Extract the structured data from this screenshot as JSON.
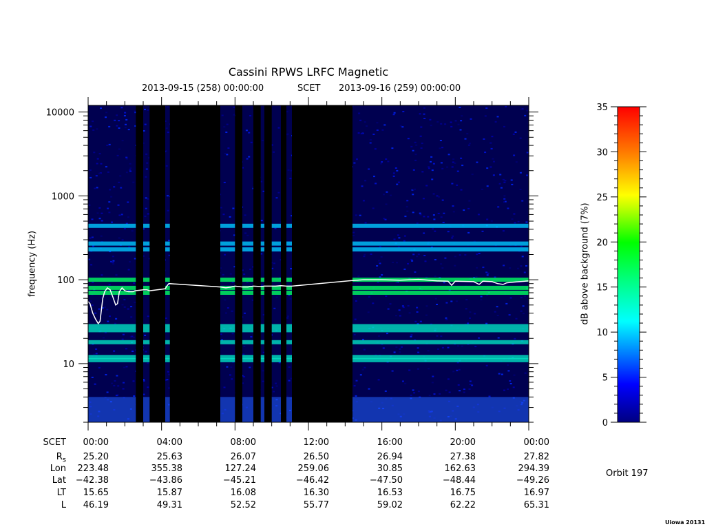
{
  "header": {
    "title": "Cassini RPWS LRFC Magnetic",
    "start_time": "2013-09-15 (258) 00:00:00",
    "scet_label": "SCET",
    "end_time": "2013-09-16 (259) 00:00:00"
  },
  "orbit_label": "Orbit 197",
  "credit": "Uiowa 20131008",
  "ephemeris": {
    "labels": [
      "SCET",
      "R",
      "Lon",
      "Lat",
      "LT",
      "L"
    ],
    "r_subscript": "s",
    "scet": [
      "00:00",
      "04:00",
      "08:00",
      "12:00",
      "16:00",
      "20:00",
      "00:00"
    ],
    "rs": [
      "25.20",
      "25.63",
      "26.07",
      "26.50",
      "26.94",
      "27.38",
      "27.82"
    ],
    "lon": [
      "223.48",
      "355.38",
      "127.24",
      "259.06",
      "30.85",
      "162.63",
      "294.39"
    ],
    "lat": [
      "−42.38",
      "−43.86",
      "−45.21",
      "−46.42",
      "−47.50",
      "−48.44",
      "−49.26"
    ],
    "lt": [
      "15.65",
      "15.87",
      "16.08",
      "16.30",
      "16.53",
      "16.75",
      "16.97"
    ],
    "l": [
      "46.19",
      "49.31",
      "52.52",
      "55.77",
      "59.02",
      "62.22",
      "65.31"
    ]
  },
  "chart_data": [
    {
      "type": "heatmap",
      "title": "Cassini RPWS LRFC Magnetic",
      "xlabel": "SCET",
      "ylabel": "frequency (Hz)",
      "y_scale": "log",
      "ylim": [
        2,
        12000
      ],
      "xlim_hours": [
        0,
        24
      ],
      "x_ticks": [
        "00:00",
        "04:00",
        "08:00",
        "12:00",
        "16:00",
        "20:00",
        "00:00"
      ],
      "y_ticks": [
        "10",
        "100",
        "1000",
        "10000"
      ],
      "no_data_intervals_hours": [
        [
          2.6,
          3.0
        ],
        [
          3.35,
          4.2
        ],
        [
          4.45,
          7.2
        ],
        [
          8.0,
          8.4
        ],
        [
          9.0,
          9.4
        ],
        [
          9.6,
          10.0
        ],
        [
          10.5,
          10.8
        ],
        [
          11.1,
          14.4
        ]
      ],
      "overlay_line": {
        "color": "#ffffff",
        "x_hours": [
          0.0,
          0.1,
          0.25,
          0.4,
          0.55,
          0.65,
          0.8,
          0.9,
          1.05,
          1.2,
          1.35,
          1.5,
          1.6,
          1.7,
          1.85,
          2.0,
          2.2,
          2.45,
          2.55,
          3.0,
          3.2,
          3.35,
          4.2,
          4.3,
          4.4,
          7.2,
          7.5,
          7.8,
          8.0,
          8.4,
          8.7,
          9.0,
          9.4,
          9.6,
          10.0,
          10.2,
          10.5,
          10.8,
          11.1,
          14.4,
          15.0,
          16.0,
          17.0,
          18.0,
          19.0,
          19.6,
          19.8,
          20.0,
          21.0,
          21.3,
          21.5,
          22.0,
          22.3,
          22.6,
          22.8,
          23.0,
          23.5,
          24.0
        ],
        "freq_hz": [
          55,
          52,
          40,
          34,
          30,
          32,
          60,
          72,
          80,
          76,
          62,
          50,
          52,
          72,
          80,
          74,
          72,
          72,
          74,
          76,
          76,
          74,
          78,
          85,
          90,
          82,
          80,
          82,
          84,
          82,
          82,
          84,
          83,
          84,
          84,
          84,
          85,
          84,
          84,
          98,
          100,
          100,
          99,
          101,
          97,
          96,
          86,
          96,
          95,
          88,
          96,
          95,
          90,
          88,
          92,
          93,
          95,
          97
        ]
      },
      "bands_hz": [
        11,
        12,
        18,
        25,
        28,
        70,
        80,
        100,
        230,
        270,
        440
      ]
    },
    {
      "type": "heatmap",
      "ylabel": "dB above background (7%)",
      "ylim": [
        0,
        35
      ],
      "y_ticks": [
        "0",
        "5",
        "10",
        "15",
        "20",
        "25",
        "30",
        "35"
      ]
    }
  ]
}
